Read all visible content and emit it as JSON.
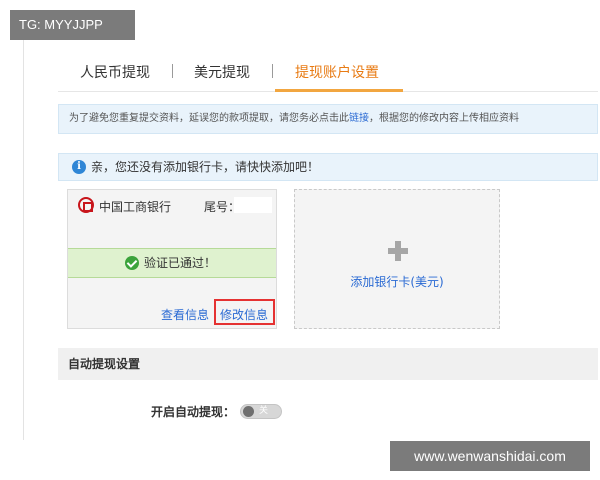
{
  "watermarks": {
    "top_left": "TG: MYYJJPP",
    "bottom_right": "www.wenwanshidai.com"
  },
  "tabs": [
    {
      "label": "人民币提现",
      "active": false
    },
    {
      "label": "美元提现",
      "active": false
    },
    {
      "label": "提现账户设置",
      "active": true
    }
  ],
  "notice": {
    "before_link": "为了避免您重复提交资料，延误您的款项提取，请您务必点击此",
    "link_text": "链接",
    "after_link": "，根据您的修改内容上传相应资料"
  },
  "tip": {
    "text": "亲，您还没有添加银行卡，请快快添加吧！"
  },
  "bank_card": {
    "bank_name": "中国工商银行",
    "tail_label": "尾号：",
    "status": "验证已通过！",
    "view_label": "查看信息",
    "edit_label": "修改信息"
  },
  "add_card": {
    "label": "添加银行卡(美元)"
  },
  "auto_withdraw": {
    "section_title": "自动提现设置",
    "label": "开启自动提现：",
    "toggle_state": "关"
  },
  "colors": {
    "accent": "#e87b14",
    "link": "#2a6ad3",
    "success": "#3ba33b",
    "highlight": "#e53232"
  }
}
